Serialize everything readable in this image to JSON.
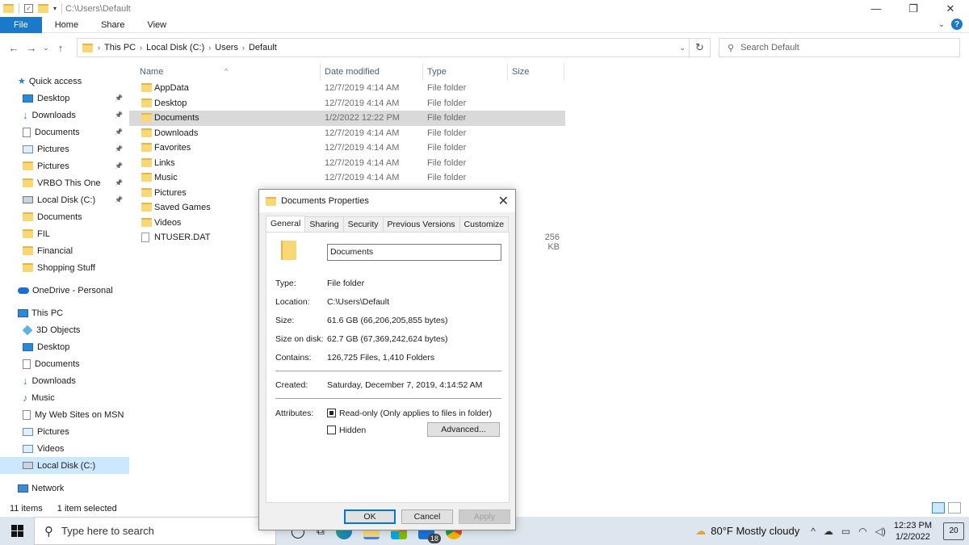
{
  "window": {
    "title_path": "C:\\Users\\Default"
  },
  "ribbon": {
    "tabs": [
      "File",
      "Home",
      "Share",
      "View"
    ]
  },
  "address": {
    "crumbs": [
      "This PC",
      "Local Disk (C:)",
      "Users",
      "Default"
    ],
    "search_placeholder": "Search Default"
  },
  "nav": {
    "quick_access": "Quick access",
    "quick_items": [
      {
        "label": "Desktop",
        "icon": "desktop-icon"
      },
      {
        "label": "Downloads",
        "icon": "downloads-icon"
      },
      {
        "label": "Documents",
        "icon": "documents-icon"
      },
      {
        "label": "Pictures",
        "icon": "pictures-icon"
      },
      {
        "label": "Pictures",
        "icon": "folder-icon"
      },
      {
        "label": "VRBO This One",
        "icon": "folder-icon"
      },
      {
        "label": "Local Disk (C:)",
        "icon": "drive-icon"
      },
      {
        "label": "Documents",
        "icon": "folder-icon"
      },
      {
        "label": "FIL",
        "icon": "folder-icon"
      },
      {
        "label": "Financial",
        "icon": "folder-icon"
      },
      {
        "label": "Shopping Stuff",
        "icon": "folder-icon"
      }
    ],
    "onedrive": "OneDrive - Personal",
    "this_pc": "This PC",
    "pc_items": [
      {
        "label": "3D Objects",
        "icon": "3d-objects-icon"
      },
      {
        "label": "Desktop",
        "icon": "desktop-icon"
      },
      {
        "label": "Documents",
        "icon": "documents-icon"
      },
      {
        "label": "Downloads",
        "icon": "downloads-icon"
      },
      {
        "label": "Music",
        "icon": "music-icon"
      },
      {
        "label": "My Web Sites on MSN",
        "icon": "web-sites-icon"
      },
      {
        "label": "Pictures",
        "icon": "pictures-icon"
      },
      {
        "label": "Videos",
        "icon": "videos-icon"
      },
      {
        "label": "Local Disk (C:)",
        "icon": "drive-icon"
      }
    ],
    "network": "Network"
  },
  "files": {
    "columns": {
      "name": "Name",
      "date": "Date modified",
      "type": "Type",
      "size": "Size"
    },
    "rows": [
      {
        "name": "AppData",
        "date": "12/7/2019 4:14 AM",
        "type": "File folder",
        "size": ""
      },
      {
        "name": "Desktop",
        "date": "12/7/2019 4:14 AM",
        "type": "File folder",
        "size": ""
      },
      {
        "name": "Documents",
        "date": "1/2/2022 12:22 PM",
        "type": "File folder",
        "size": ""
      },
      {
        "name": "Downloads",
        "date": "12/7/2019 4:14 AM",
        "type": "File folder",
        "size": ""
      },
      {
        "name": "Favorites",
        "date": "12/7/2019 4:14 AM",
        "type": "File folder",
        "size": ""
      },
      {
        "name": "Links",
        "date": "12/7/2019 4:14 AM",
        "type": "File folder",
        "size": ""
      },
      {
        "name": "Music",
        "date": "12/7/2019 4:14 AM",
        "type": "File folder",
        "size": ""
      },
      {
        "name": "Pictures",
        "date": "",
        "type": "",
        "size": ""
      },
      {
        "name": "Saved Games",
        "date": "",
        "type": "",
        "size": ""
      },
      {
        "name": "Videos",
        "date": "",
        "type": "",
        "size": ""
      },
      {
        "name": "NTUSER.DAT",
        "date": "",
        "type": "",
        "size": "256 KB"
      }
    ]
  },
  "status": {
    "count": "11 items",
    "selected": "1 item selected"
  },
  "dialog": {
    "title": "Documents Properties",
    "tabs": [
      "General",
      "Sharing",
      "Security",
      "Previous Versions",
      "Customize"
    ],
    "name": "Documents",
    "labels": {
      "type": "Type:",
      "location": "Location:",
      "size": "Size:",
      "size_on_disk": "Size on disk:",
      "contains": "Contains:",
      "created": "Created:",
      "attributes": "Attributes:"
    },
    "values": {
      "type": "File folder",
      "location": "C:\\Users\\Default",
      "size": "61.6 GB (66,206,205,855 bytes)",
      "size_on_disk": "62.7 GB (67,369,242,624 bytes)",
      "contains": "126,725 Files, 1,410 Folders",
      "created": "Saturday, December 7, 2019, 4:14:52 AM"
    },
    "readonly_label": "Read-only (Only applies to files in folder)",
    "hidden_label": "Hidden",
    "advanced": "Advanced...",
    "ok": "OK",
    "cancel": "Cancel",
    "apply": "Apply"
  },
  "taskbar": {
    "search_placeholder": "Type here to search",
    "badge": "18",
    "weather": "80°F  Mostly cloudy",
    "time": "12:23 PM",
    "date": "1/2/2022",
    "notifications": "20"
  }
}
